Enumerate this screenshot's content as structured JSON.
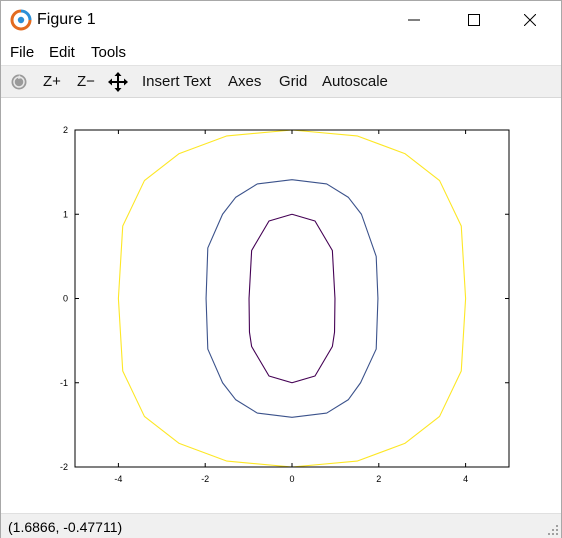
{
  "window": {
    "title": "Figure 1"
  },
  "menubar": {
    "file": "File",
    "edit": "Edit",
    "tools": "Tools"
  },
  "toolbar": {
    "zoom_in": "Z+",
    "zoom_out": "Z−",
    "insert_text": "Insert Text",
    "axes": "Axes",
    "grid": "Grid",
    "autoscale": "Autoscale"
  },
  "status": {
    "coordinates": "(1.6866, -0.47711)"
  },
  "chart_data": {
    "type": "contour",
    "title": "",
    "xlabel": "",
    "ylabel": "",
    "xlim": [
      -5,
      5
    ],
    "ylim": [
      -2,
      2
    ],
    "xticks": [
      -4,
      -2,
      0,
      2,
      4
    ],
    "yticks": [
      -2,
      -1,
      0,
      1,
      2
    ],
    "grid": false,
    "series": [
      {
        "level": 1,
        "color": "#440154",
        "x": [
          0,
          0.53,
          0.93,
          0.99,
          0.98,
          0.93,
          0.53,
          0,
          -0.53,
          -0.93,
          -0.98,
          -0.99,
          -0.93,
          -0.53,
          0
        ],
        "y": [
          1,
          0.92,
          0.57,
          0,
          -0.4,
          -0.57,
          -0.92,
          -1,
          -0.92,
          -0.57,
          -0.4,
          0,
          0.57,
          0.92,
          1
        ]
      },
      {
        "level": 2,
        "color": "#3b528b",
        "x": [
          0,
          0.8,
          1.3,
          1.6,
          1.94,
          1.98,
          1.94,
          1.58,
          1.3,
          0.8,
          0,
          -0.8,
          -1.3,
          -1.6,
          -1.94,
          -1.98,
          -1.94,
          -1.6,
          -1.3,
          -0.8,
          0
        ],
        "y": [
          1.41,
          1.36,
          1.2,
          1.0,
          0.5,
          0,
          -0.6,
          -1.0,
          -1.2,
          -1.36,
          -1.41,
          -1.36,
          -1.2,
          -1.0,
          -0.6,
          0,
          0.6,
          1.0,
          1.2,
          1.36,
          1.41
        ]
      },
      {
        "level": 4,
        "color": "#fde725",
        "x": [
          0,
          1.5,
          2.6,
          3.4,
          3.9,
          4.0,
          3.9,
          3.4,
          2.6,
          1.5,
          0,
          -1.5,
          -2.6,
          -3.4,
          -3.9,
          -4.0,
          -3.9,
          -3.4,
          -2.6,
          -1.5,
          0
        ],
        "y": [
          2,
          1.93,
          1.72,
          1.4,
          0.86,
          0,
          -0.86,
          -1.4,
          -1.72,
          -1.93,
          -2,
          -1.93,
          -1.72,
          -1.4,
          -0.86,
          0,
          0.86,
          1.4,
          1.72,
          1.93,
          2
        ]
      }
    ]
  }
}
